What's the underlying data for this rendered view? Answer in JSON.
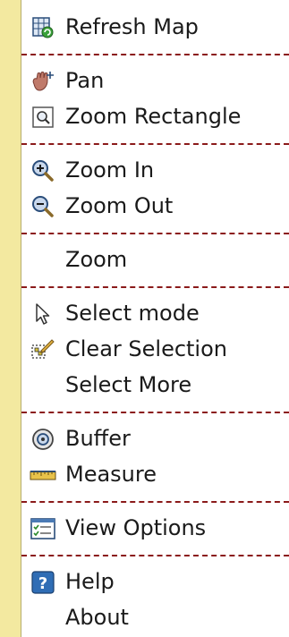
{
  "menu": {
    "items": [
      {
        "label": "Refresh Map",
        "icon": "refresh-map-icon"
      },
      {
        "label": "Pan",
        "icon": "pan-hand-icon"
      },
      {
        "label": "Zoom Rectangle",
        "icon": "zoom-rectangle-icon"
      },
      {
        "label": "Zoom In",
        "icon": "zoom-in-icon"
      },
      {
        "label": "Zoom Out",
        "icon": "zoom-out-icon"
      },
      {
        "label": "Zoom",
        "icon": ""
      },
      {
        "label": "Select mode",
        "icon": "select-arrow-icon"
      },
      {
        "label": "Clear Selection",
        "icon": "clear-selection-icon"
      },
      {
        "label": "Select More",
        "icon": ""
      },
      {
        "label": "Buffer",
        "icon": "buffer-icon"
      },
      {
        "label": "Measure",
        "icon": "ruler-icon"
      },
      {
        "label": "View Options",
        "icon": "view-options-icon"
      },
      {
        "label": "Help",
        "icon": "help-icon"
      },
      {
        "label": "About",
        "icon": ""
      }
    ]
  }
}
